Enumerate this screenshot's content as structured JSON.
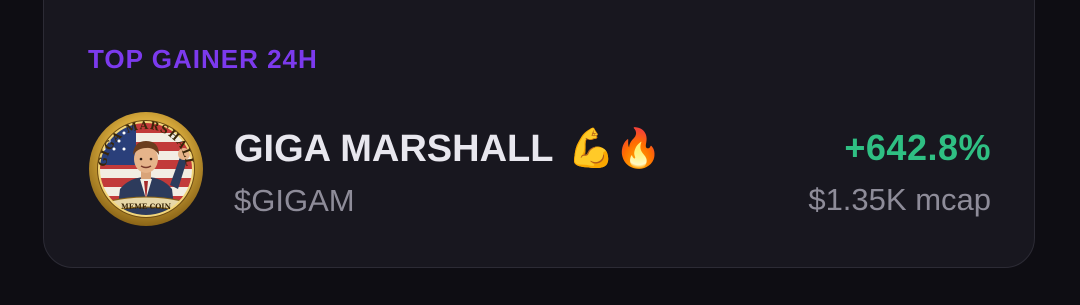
{
  "section": {
    "label": "TOP GAINER 24H"
  },
  "token": {
    "name": "GIGA MARSHALL",
    "emoji": "💪🔥",
    "ticker": "$GIGAM",
    "change": "+642.8%",
    "mcap": "$1.35K mcap",
    "coin_texts": {
      "top": "GIGA MARSHALL",
      "bottom": "MEME COIN"
    }
  },
  "colors": {
    "accent": "#7c3aed",
    "positive": "#2fbf83",
    "muted": "#8e8c99",
    "card_bg": "#18171f",
    "page_bg": "#0e0d13"
  }
}
